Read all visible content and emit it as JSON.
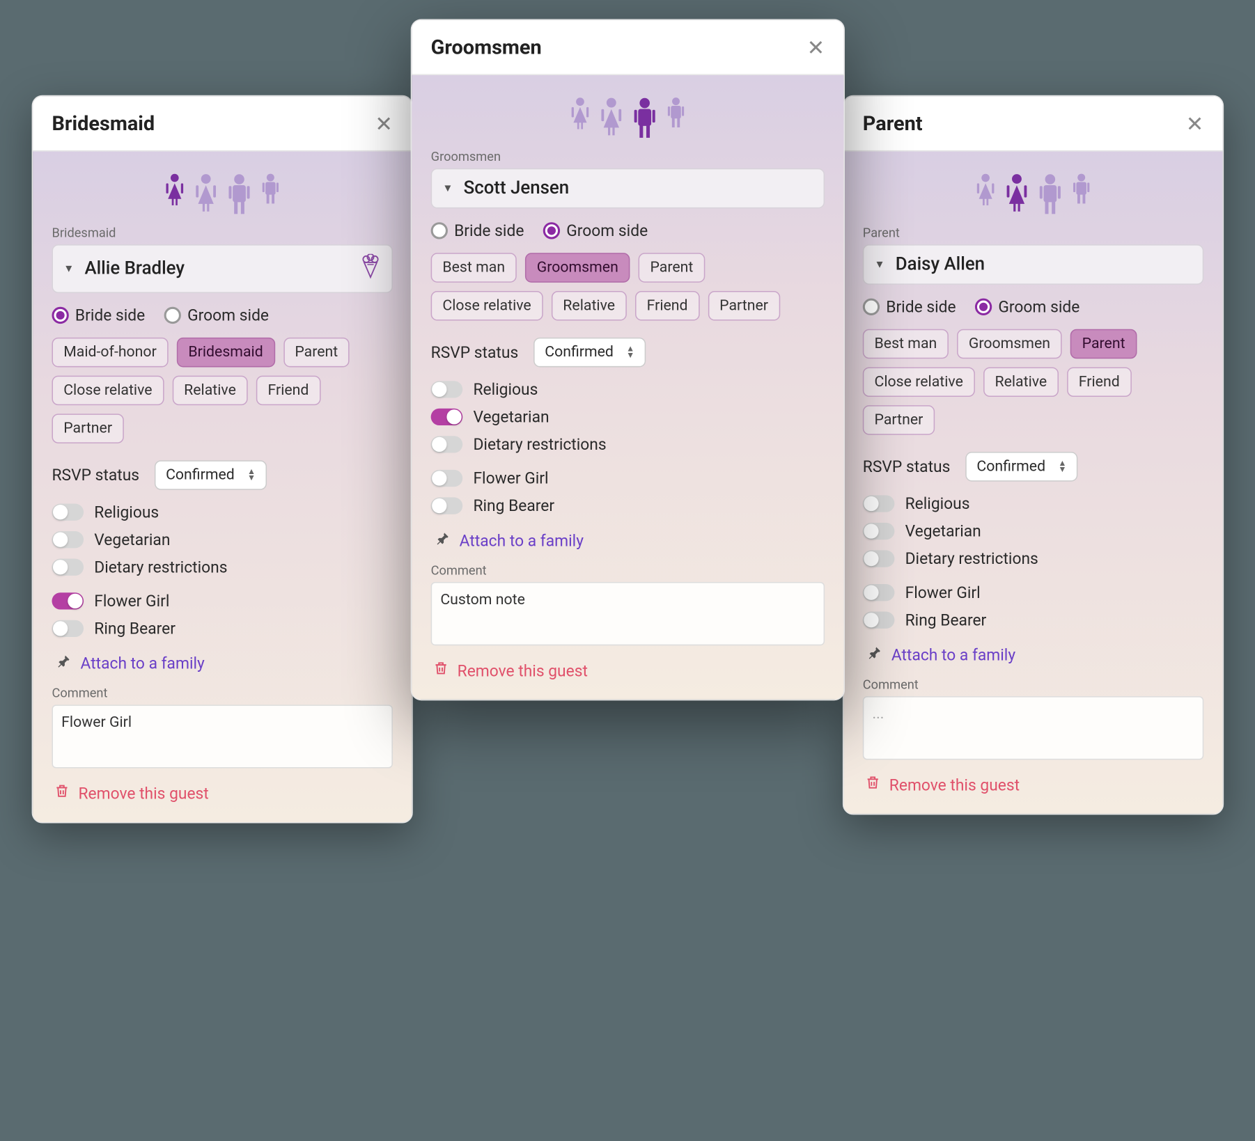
{
  "labels": {
    "bride_side": "Bride side",
    "groom_side": "Groom side",
    "rsvp_status": "RSVP status",
    "religious": "Religious",
    "vegetarian": "Vegetarian",
    "dietary": "Dietary restrictions",
    "flower_girl": "Flower Girl",
    "ring_bearer": "Ring Bearer",
    "attach_family": "Attach to a family",
    "comment": "Comment",
    "remove_guest": "Remove this guest"
  },
  "role_options": {
    "bride": [
      "Maid-of-honor",
      "Bridesmaid",
      "Parent",
      "Close relative",
      "Relative",
      "Friend",
      "Partner"
    ],
    "groom": [
      "Best man",
      "Groomsmen",
      "Parent",
      "Close relative",
      "Relative",
      "Friend",
      "Partner"
    ]
  },
  "cards": [
    {
      "id": "left",
      "title": "Bridesmaid",
      "role_label": "Bridesmaid",
      "name": "Allie Bradley",
      "has_bouquet": true,
      "side": "bride",
      "role_set": "bride",
      "selected_role": "Bridesmaid",
      "rsvp": "Confirmed",
      "toggles": {
        "religious": false,
        "vegetarian": false,
        "dietary": false,
        "flower_girl": true,
        "ring_bearer": false
      },
      "comment": "Flower Girl",
      "selected_figure": 0
    },
    {
      "id": "center",
      "title": "Groomsmen",
      "role_label": "Groomsmen",
      "name": "Scott Jensen",
      "has_bouquet": false,
      "side": "groom",
      "role_set": "groom",
      "selected_role": "Groomsmen",
      "rsvp": "Confirmed",
      "toggles": {
        "religious": false,
        "vegetarian": true,
        "dietary": false,
        "flower_girl": false,
        "ring_bearer": false
      },
      "comment": "Custom note",
      "selected_figure": 2
    },
    {
      "id": "right",
      "title": "Parent",
      "role_label": "Parent",
      "name": "Daisy Allen",
      "has_bouquet": false,
      "side": "groom",
      "role_set": "groom",
      "selected_role": "Parent",
      "rsvp": "Confirmed",
      "toggles": {
        "religious": false,
        "vegetarian": false,
        "dietary": false,
        "flower_girl": false,
        "ring_bearer": false
      },
      "comment": "",
      "comment_placeholder": "...",
      "selected_figure": 1
    }
  ]
}
